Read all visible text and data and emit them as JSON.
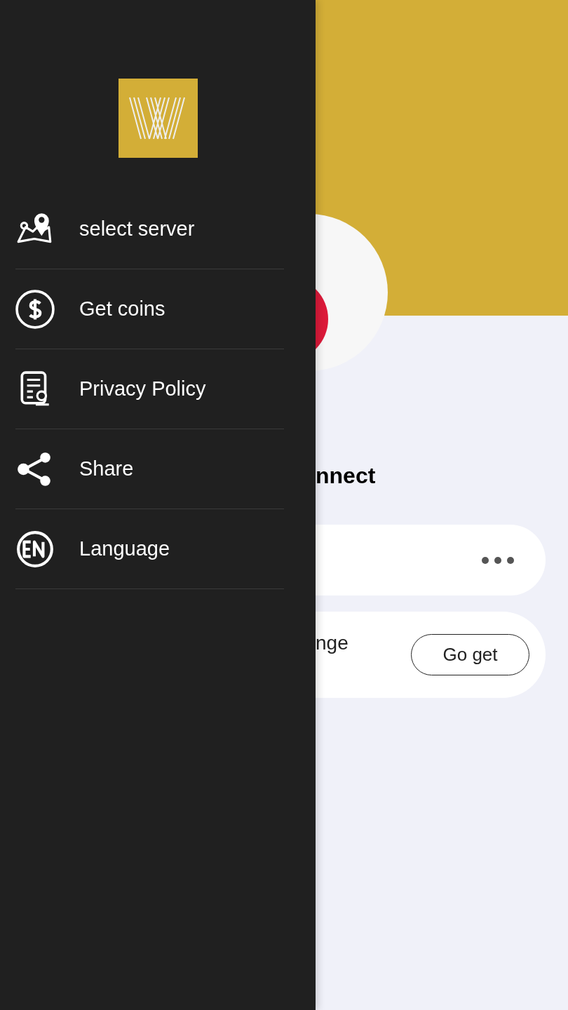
{
  "drawer": {
    "menu_items": [
      {
        "label": "select server"
      },
      {
        "label": "Get coins"
      },
      {
        "label": "Privacy Policy"
      },
      {
        "label": "Share"
      },
      {
        "label": "Language"
      }
    ]
  },
  "main": {
    "heading": "nnect",
    "coins_card": {
      "text": "nge",
      "button": "Go get"
    }
  }
}
